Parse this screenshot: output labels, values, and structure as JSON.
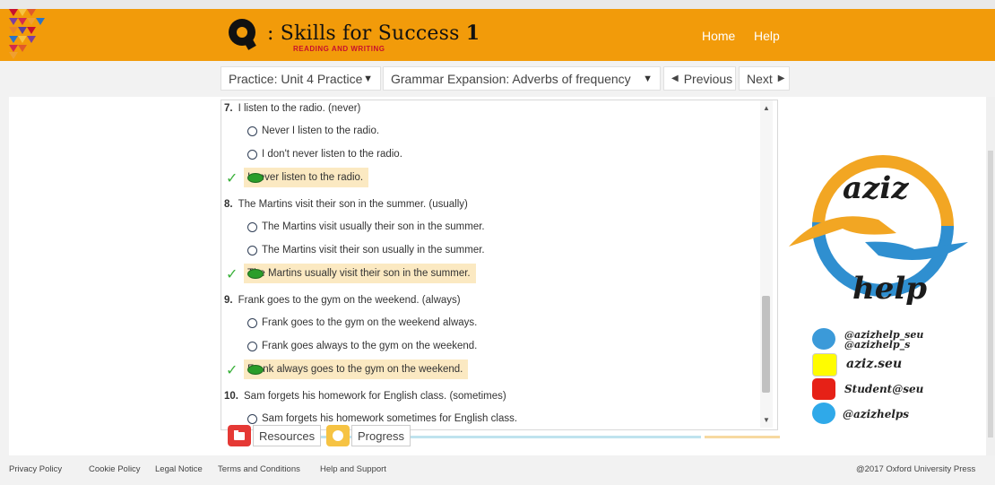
{
  "header": {
    "brand_title_q": "Q",
    "brand_title": ": Skills for Success",
    "brand_level": "1",
    "brand_subtitle": "READING AND WRITING",
    "nav": [
      "Home",
      "Help"
    ]
  },
  "selectors": {
    "practice": "Practice: Unit 4 Practice",
    "grammar": "Grammar Expansion: Adverbs of frequency",
    "previous": "Previous",
    "next": "Next"
  },
  "questions": [
    {
      "number": "7.",
      "prompt": "I listen to the radio. (never)",
      "options": [
        "Never I listen to the radio.",
        "I don't never listen to the radio.",
        "I never listen to the radio."
      ],
      "selected": 2
    },
    {
      "number": "8.",
      "prompt": "The Martins visit their son in the summer. (usually)",
      "options": [
        "The Martins visit usually their son in the summer.",
        "The Martins visit their son usually in the summer.",
        "The Martins usually visit their son in the summer."
      ],
      "selected": 2
    },
    {
      "number": "9.",
      "prompt": "Frank goes to the gym on the weekend. (always)",
      "options": [
        "Frank goes to the gym on the weekend always.",
        "Frank goes always to the gym on the weekend.",
        "Frank always goes to the gym on the weekend."
      ],
      "selected": 2
    },
    {
      "number": "10.",
      "prompt": "Sam forgets his homework for English class. (sometimes)",
      "options": [
        "Sam forgets his homework sometimes for English class."
      ],
      "selected": -1
    }
  ],
  "bottom_buttons": {
    "resources": "Resources",
    "progress": "Progress"
  },
  "watermark": {
    "top_word": "aziz",
    "bottom_word": "help",
    "telegram": "@azizhelp_seu",
    "telegram2": "@azizhelp_s",
    "snapchat": "aziz.seu",
    "youtube": "Student@seu",
    "twitter": "@azizhelps"
  },
  "footer": {
    "links": [
      "Privacy Policy",
      "Cookie Policy",
      "Legal Notice",
      "Terms and Conditions",
      "Help and Support"
    ],
    "copyright": "@2017 Oxford University Press"
  },
  "colors": {
    "header": "#f29b0a",
    "correct_highlight": "#fbe9c2",
    "check": "#3bb13b",
    "selected_radio": "#2a9d2a"
  }
}
